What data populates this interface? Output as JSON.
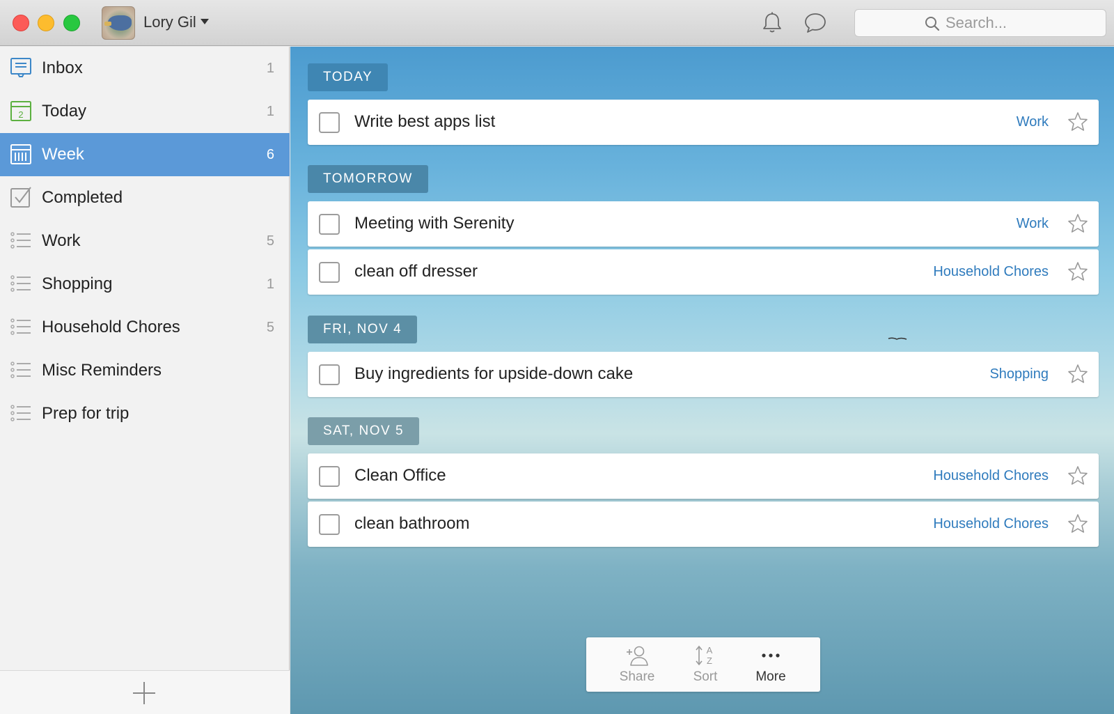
{
  "window": {
    "user_name": "Lory Gil",
    "search_placeholder": "Search..."
  },
  "sidebar": {
    "items": [
      {
        "label": "Inbox",
        "count": "1",
        "icon": "inbox-icon"
      },
      {
        "label": "Today",
        "count": "1",
        "icon": "today-calendar-icon",
        "icon_text": "2"
      },
      {
        "label": "Week",
        "count": "6",
        "icon": "week-calendar-icon",
        "active": true
      },
      {
        "label": "Completed",
        "count": "",
        "icon": "completed-check-icon"
      },
      {
        "label": "Work",
        "count": "5",
        "icon": "list-icon"
      },
      {
        "label": "Shopping",
        "count": "1",
        "icon": "list-icon"
      },
      {
        "label": "Household Chores",
        "count": "5",
        "icon": "list-icon"
      },
      {
        "label": "Misc Reminders",
        "count": "",
        "icon": "list-icon"
      },
      {
        "label": "Prep for trip",
        "count": "",
        "icon": "list-icon"
      }
    ]
  },
  "main": {
    "sections": [
      {
        "header": "TODAY",
        "tasks": [
          {
            "title": "Write best apps list",
            "list": "Work"
          }
        ]
      },
      {
        "header": "TOMORROW",
        "tasks": [
          {
            "title": "Meeting with Serenity",
            "list": "Work"
          },
          {
            "title": "clean off dresser",
            "list": "Household Chores"
          }
        ]
      },
      {
        "header": "FRI, NOV 4",
        "tasks": [
          {
            "title": "Buy ingredients for upside-down cake",
            "list": "Shopping"
          }
        ]
      },
      {
        "header": "SAT, NOV 5",
        "tasks": [
          {
            "title": "Clean Office",
            "list": "Household Chores"
          },
          {
            "title": "clean bathroom",
            "list": "Household Chores"
          }
        ]
      }
    ],
    "toolbar": {
      "share_label": "Share",
      "sort_label": "Sort",
      "more_label": "More"
    }
  },
  "colors": {
    "accent": "#5b99d8",
    "list_link": "#2f7bbd",
    "section_header": "#3f86b3"
  }
}
